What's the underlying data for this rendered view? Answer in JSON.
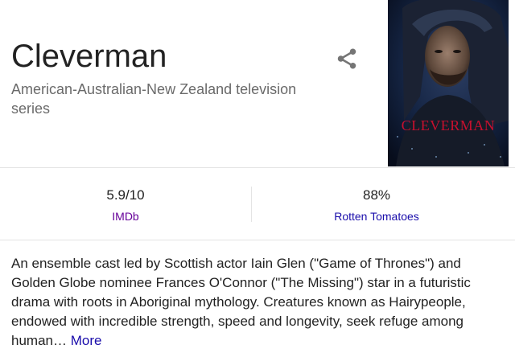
{
  "knowledge_panel": {
    "title": "Cleverman",
    "subtitle": "American-Australian-New Zealand television series",
    "share_icon": "share-icon",
    "poster": {
      "text": "CLEVERMAN",
      "text_color": "#c8102e"
    },
    "ratings": [
      {
        "score": "5.9/10",
        "source": "IMDb"
      },
      {
        "score": "88%",
        "source": "Rotten Tomatoes"
      }
    ],
    "description": {
      "text": "An ensemble cast led by Scottish actor Iain Glen (\"Game of Thrones\") and Golden Globe nominee Frances O'Connor (\"The Missing\") star in a futuristic drama with roots in Aboriginal mythology. Creatures known as Hairypeople, endowed with incredible strength, speed and longevity, seek refuge among human…",
      "more_label": "More"
    },
    "colors": {
      "link": "#1a0dab",
      "visited_link": "#660099",
      "subtitle": "#6a6a6a"
    }
  }
}
